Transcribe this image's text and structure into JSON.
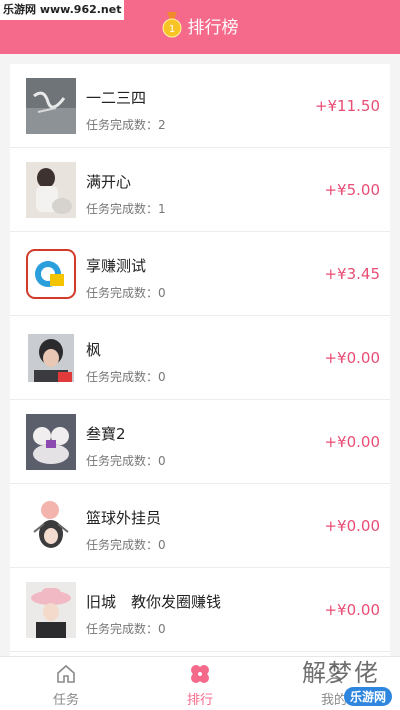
{
  "watermark_top": "乐游网 www.962.net",
  "header": {
    "title": "排行榜",
    "medal_icon": "gold-medal-icon"
  },
  "rows": [
    {
      "name": "一二三四",
      "tasks_label": "任务完成数：",
      "tasks": "2",
      "amount": "+¥11.50"
    },
    {
      "name": "满开心",
      "tasks_label": "任务完成数：",
      "tasks": "1",
      "amount": "+¥5.00"
    },
    {
      "name": "享赚测试",
      "tasks_label": "任务完成数：",
      "tasks": "0",
      "amount": "+¥3.45"
    },
    {
      "name": "枫",
      "tasks_label": "任务完成数：",
      "tasks": "0",
      "amount": "+¥0.00"
    },
    {
      "name": "叁寶2",
      "tasks_label": "任务完成数：",
      "tasks": "0",
      "amount": "+¥0.00"
    },
    {
      "name": "篮球外挂员",
      "tasks_label": "任务完成数：",
      "tasks": "0",
      "amount": "+¥0.00"
    },
    {
      "name": "旧城　教你发圈赚钱",
      "tasks_label": "任务完成数：",
      "tasks": "0",
      "amount": "+¥0.00"
    }
  ],
  "tabs": [
    {
      "label": "任务",
      "icon": "home-icon",
      "active": false
    },
    {
      "label": "排行",
      "icon": "flower-icon",
      "active": true
    },
    {
      "label": "我的",
      "icon": "person-icon",
      "active": false
    }
  ],
  "watermark_bottom": {
    "big": "解梦佬",
    "small": "乐游网"
  },
  "colors": {
    "accent": "#f5698a",
    "amount": "#e94d74"
  }
}
